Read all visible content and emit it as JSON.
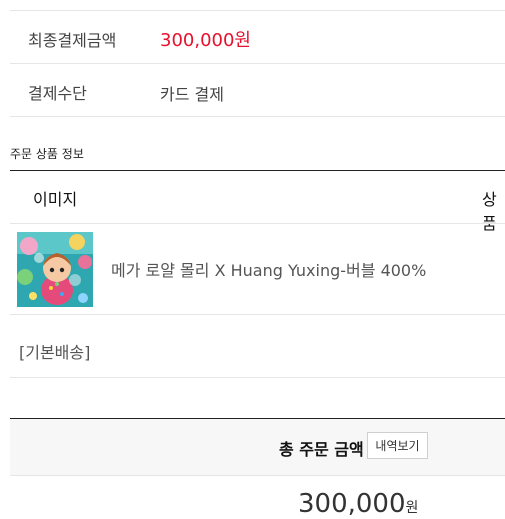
{
  "payment": {
    "final_amount_label": "최종결제금액",
    "final_amount_value": "300,000원",
    "method_label": "결제수단",
    "method_value": "카드 결제"
  },
  "order_products": {
    "section_title": "주문 상품 정보",
    "columns": [
      "이미지",
      "상품"
    ],
    "items": [
      {
        "name": "메가 로얄 몰리 X Huang Yuxing-버블 400%"
      }
    ],
    "shipping_group": "[기본배송]"
  },
  "summary": {
    "total_label": "총 주문 금액",
    "detail_button": "내역보기",
    "total_amount": "300,000",
    "total_unit": "원"
  },
  "colors": {
    "accent_red": "#e8112d",
    "total_bg": "#f7f7f7"
  }
}
